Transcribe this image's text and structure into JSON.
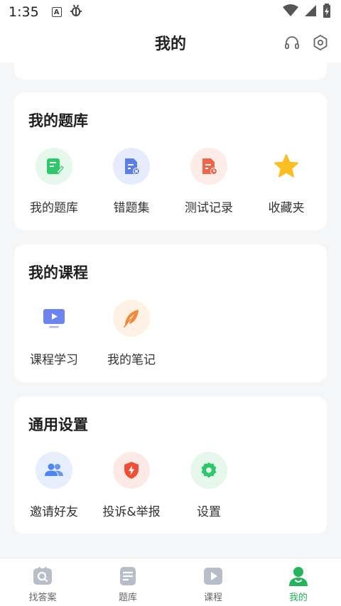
{
  "status_bar": {
    "time": "1:35",
    "a_icon": "A"
  },
  "header": {
    "title": "我的"
  },
  "sections": {
    "tiku": {
      "title": "我的题库",
      "items": [
        {
          "label": "我的题库",
          "icon": "edit-doc-icon",
          "bg": "#e6f8ec",
          "fg": "#2ec76a"
        },
        {
          "label": "错题集",
          "icon": "error-doc-icon",
          "bg": "#e6ecfb",
          "fg": "#5b7ee8"
        },
        {
          "label": "测试记录",
          "icon": "clock-doc-icon",
          "bg": "#fdece8",
          "fg": "#f0664a"
        },
        {
          "label": "收藏夹",
          "icon": "star-icon",
          "bg": "#ffffff",
          "fg": "#fbbf24"
        }
      ]
    },
    "course": {
      "title": "我的课程",
      "items": [
        {
          "label": "课程学习",
          "icon": "video-screen-icon",
          "bg": "#ffffff",
          "fg": "#6b84f0"
        },
        {
          "label": "我的笔记",
          "icon": "feather-icon",
          "bg": "#fff1e4",
          "fg": "#f38a3b"
        }
      ]
    },
    "settings": {
      "title": "通用设置",
      "items": [
        {
          "label": "邀请好友",
          "icon": "users-icon",
          "bg": "#e6eefc",
          "fg": "#4d86ee"
        },
        {
          "label": "投诉&举报",
          "icon": "shield-icon",
          "bg": "#fdeae7",
          "fg": "#f04e37"
        },
        {
          "label": "设置",
          "icon": "gear-icon",
          "bg": "#e6f8ec",
          "fg": "#2ec76a"
        }
      ]
    }
  },
  "tabs": [
    {
      "label": "找答案",
      "icon": "search-icon",
      "active": false
    },
    {
      "label": "题库",
      "icon": "document-icon",
      "active": false
    },
    {
      "label": "课程",
      "icon": "play-icon",
      "active": false
    },
    {
      "label": "我的",
      "icon": "user-icon",
      "active": true
    }
  ],
  "colors": {
    "accent": "#22b35b",
    "inactive": "#b8bec9"
  }
}
